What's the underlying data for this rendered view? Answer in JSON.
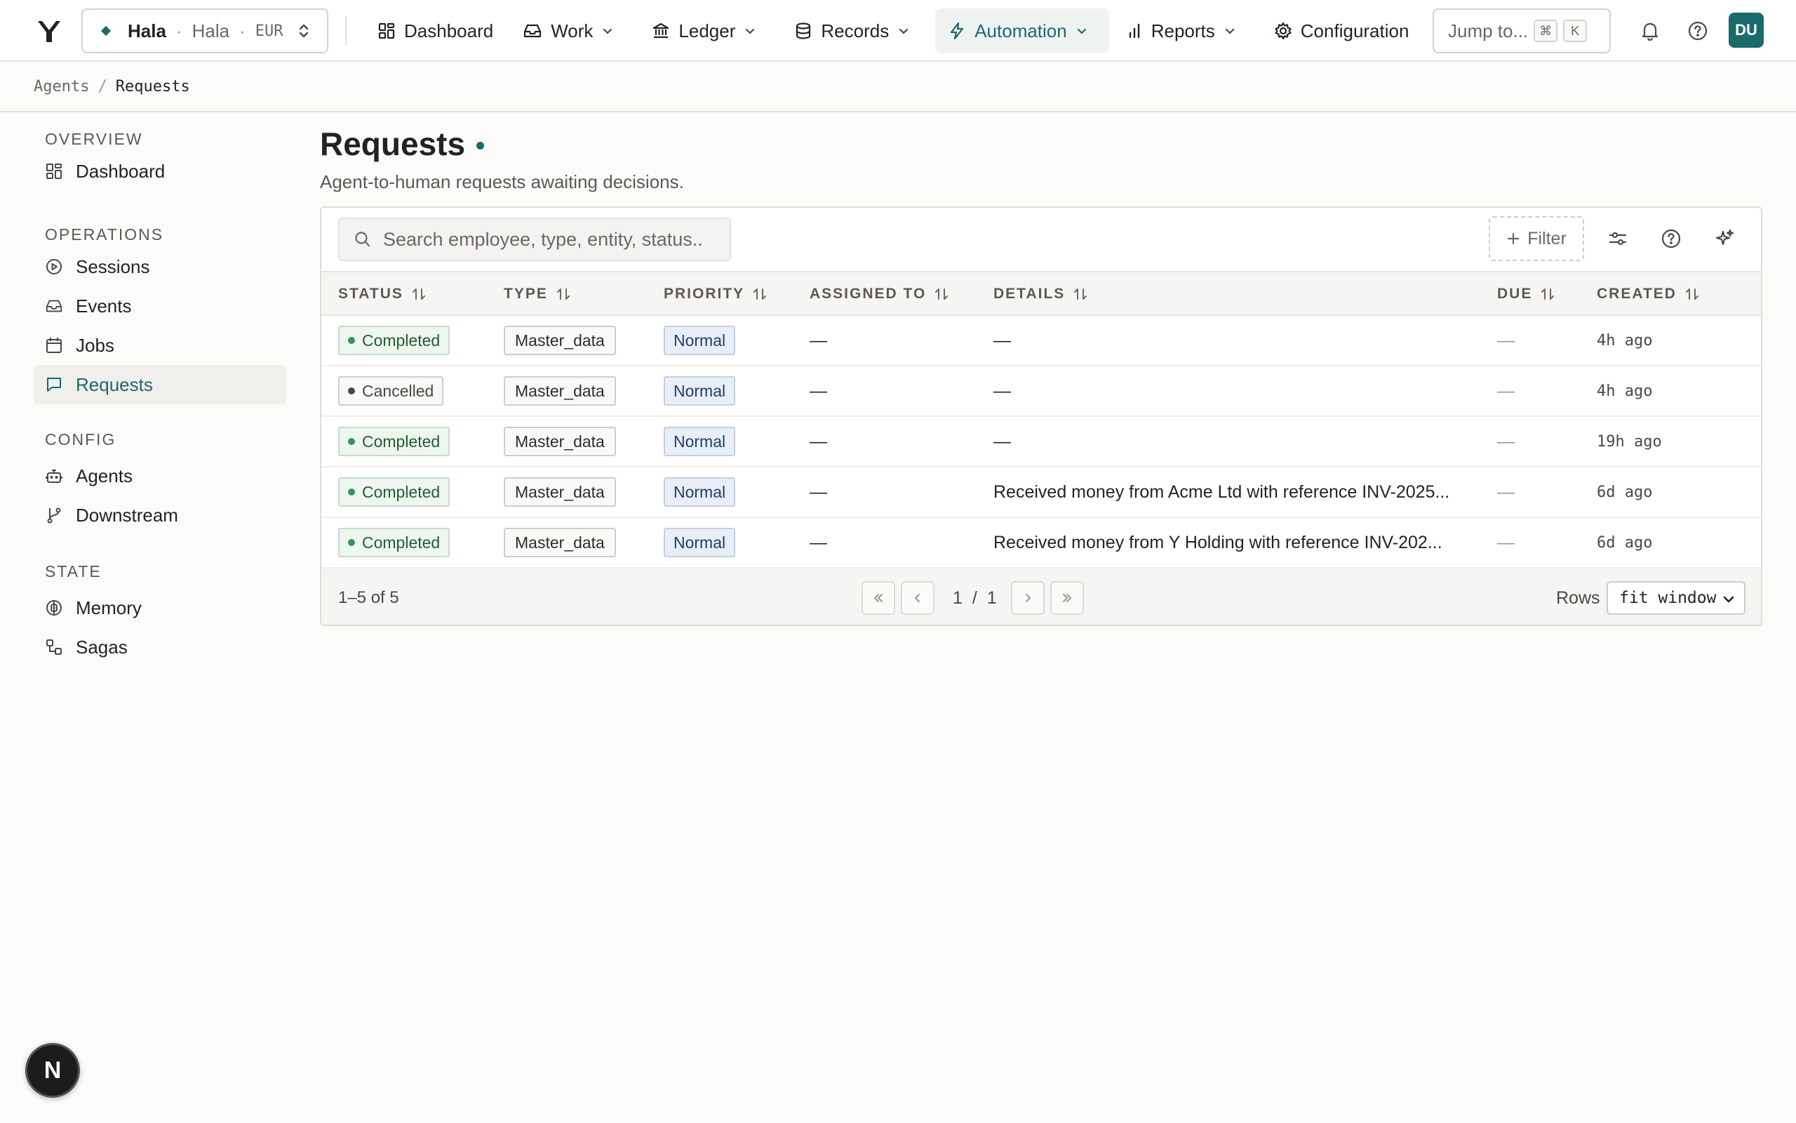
{
  "entity": {
    "name": "Hala",
    "sub": "Hala",
    "currency": "EUR",
    "separator": "·"
  },
  "nav": {
    "dashboard": "Dashboard",
    "work": "Work",
    "ledger": "Ledger",
    "records": "Records",
    "automation": "Automation",
    "reports": "Reports",
    "configuration": "Configuration"
  },
  "jump": {
    "label": "Jump to...",
    "key1": "⌘",
    "key2": "K"
  },
  "user": {
    "initials": "DU"
  },
  "breadcrumb": {
    "parent": "Agents",
    "separator": "/",
    "current": "Requests"
  },
  "sidebar": {
    "sections": {
      "overview": "Overview",
      "operations": "Operations",
      "config": "Config",
      "state": "State"
    },
    "items": {
      "dashboard": "Dashboard",
      "sessions": "Sessions",
      "events": "Events",
      "jobs": "Jobs",
      "requests": "Requests",
      "agents": "Agents",
      "downstream": "Downstream",
      "memory": "Memory",
      "sagas": "Sagas"
    }
  },
  "page": {
    "title": "Requests",
    "subtitle": "Agent-to-human requests awaiting decisions."
  },
  "search": {
    "placeholder": "Search employee, type, entity, status..",
    "value": ""
  },
  "toolbar": {
    "filter_label": "Filter"
  },
  "table": {
    "columns": {
      "status": "Status",
      "type": "Type",
      "priority": "Priority",
      "assigned": "Assigned to",
      "details": "Details",
      "due": "Due",
      "created": "Created"
    },
    "rows": [
      {
        "status": "Completed",
        "type": "Master_data",
        "priority": "Normal",
        "assigned": "—",
        "details": "—",
        "due": "—",
        "created": "4h ago"
      },
      {
        "status": "Cancelled",
        "type": "Master_data",
        "priority": "Normal",
        "assigned": "—",
        "details": "—",
        "due": "—",
        "created": "4h ago"
      },
      {
        "status": "Completed",
        "type": "Master_data",
        "priority": "Normal",
        "assigned": "—",
        "details": "—",
        "due": "—",
        "created": "19h ago"
      },
      {
        "status": "Completed",
        "type": "Master_data",
        "priority": "Normal",
        "assigned": "—",
        "details": "Received money from Acme Ltd with reference INV-2025...",
        "due": "—",
        "created": "6d ago"
      },
      {
        "status": "Completed",
        "type": "Master_data",
        "priority": "Normal",
        "assigned": "—",
        "details": "Received money from Y Holding with reference INV-202...",
        "due": "—",
        "created": "6d ago"
      }
    ]
  },
  "footer": {
    "range": "1–5 of 5",
    "page_current": "1",
    "page_sep": "/",
    "page_total": "1",
    "rows_label": "Rows",
    "rows_value": "fit window"
  },
  "fab": {
    "label": "N"
  },
  "colors": {
    "accent": "#1a6b6b",
    "success": "#2e9a52",
    "priority": "#1e3f6e"
  }
}
